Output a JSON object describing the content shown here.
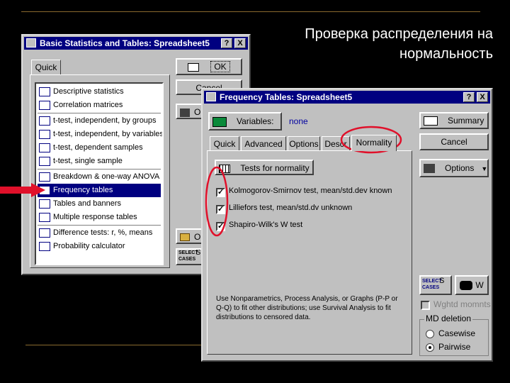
{
  "slide": {
    "title_line1": "Проверка распределения на",
    "title_line2": "нормальность"
  },
  "basic_window": {
    "title": "Basic Statistics and Tables: Spreadsheet5",
    "help_glyph": "?",
    "close_glyph": "X",
    "tab": "Quick",
    "ok_label": "OK",
    "cancel_label": "Cancel",
    "options_label": "O",
    "open_label": "O",
    "select_cases_label": "SELECT CASES",
    "s_label": "S",
    "items": [
      {
        "label": "Descriptive statistics",
        "icon": "descriptive-icon"
      },
      {
        "label": "Correlation matrices",
        "icon": "matrix-icon"
      },
      {
        "label": "t-test, independent, by groups",
        "icon": "ttest-icon"
      },
      {
        "label": "t-test, independent, by variables",
        "icon": "ttest-icon"
      },
      {
        "label": "t-test, dependent samples",
        "icon": "ttest-icon"
      },
      {
        "label": "t-test, single sample",
        "icon": "ttest-single-icon"
      },
      {
        "label": "Breakdown & one-way ANOVA",
        "icon": "breakdown-icon"
      },
      {
        "label": "Frequency tables",
        "icon": "frequency-icon"
      },
      {
        "label": "Tables and banners",
        "icon": "table-icon"
      },
      {
        "label": "Multiple response tables",
        "icon": "table-icon"
      },
      {
        "label": "Difference tests: r, %, means",
        "icon": "difference-icon"
      },
      {
        "label": "Probability calculator",
        "icon": "probability-icon"
      }
    ],
    "selected_index": 7
  },
  "freq_window": {
    "title": "Frequency Tables: Spreadsheet5",
    "help_glyph": "?",
    "close_glyph": "X",
    "variables_label": "Variables:",
    "variables_value": "none",
    "summary_label": "Summary",
    "cancel_label": "Cancel",
    "options_label": "Options",
    "tabs": [
      "Quick",
      "Advanced",
      "Options",
      "Descr",
      "Normality"
    ],
    "tests_button": "Tests for normality",
    "checks": [
      {
        "label": "Kolmogorov-Smirnov test, mean/std.dev known",
        "checked": true
      },
      {
        "label": "Lilliefors test, mean/std.dv unknown",
        "checked": true
      },
      {
        "label": "Shapiro-Wilk's W test",
        "checked": true
      }
    ],
    "hint": "Use Nonparametrics, Process Analysis, or Graphs (P-P or Q-Q) to fit other distributions; use Survival Analysis to fit distributions to censored data.",
    "select_cases_label": "SELECT CASES",
    "s_label": "S",
    "w_label": "W",
    "wghtd_label": "Wghtd momnts",
    "md_deletion_label": "MD deletion",
    "casewise_label": "Casewise",
    "pairwise_label": "Pairwise",
    "md_selected": "Pairwise"
  },
  "colors": {
    "background": "#000000",
    "window_face": "#c0c0c0",
    "titlebar": "#000080",
    "highlight_circle": "#e0102a",
    "arrow": "#e0102a"
  }
}
